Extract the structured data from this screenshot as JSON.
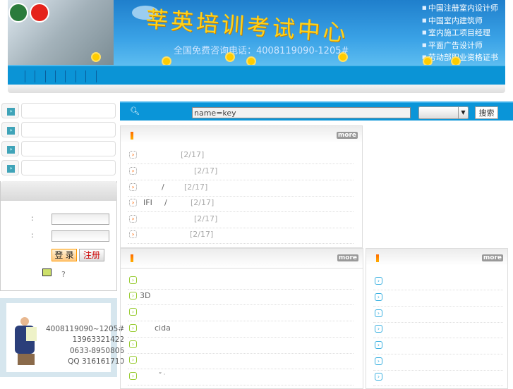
{
  "header": {
    "title": "莘英培训考试中心",
    "phone": "全国免费咨询电话：4008119090-1205#",
    "courses": [
      "中国注册室内设计师",
      "中国室内建筑师",
      "室内施工项目经理",
      "平面广告设计师",
      "劳动部职业资格证书"
    ]
  },
  "search": {
    "value": "name=key",
    "button": "搜索",
    "icon": "magnifier-icon"
  },
  "login": {
    "colon1": ":",
    "colon2": ":",
    "login_button": "登 录",
    "register_button": "注册",
    "help": "?"
  },
  "contact": {
    "lines": [
      "4008119090~1205#",
      "13963321422",
      "0633-8950806",
      "QQ 316161710"
    ]
  },
  "panels": {
    "more": "more",
    "news": [
      {
        "t": "",
        "d": "[2/17]"
      },
      {
        "t": "",
        "d": "[2/17]"
      },
      {
        "t": "/",
        "d": "[2/17]"
      },
      {
        "t": "IFI",
        "t2": "/",
        "d": "[2/17]"
      },
      {
        "t": "",
        "d": "[2/17]"
      },
      {
        "t": "",
        "d": "[2/17]"
      }
    ],
    "middle": [
      "",
      "3D",
      "",
      "cida",
      "",
      "",
      "“ ·"
    ]
  },
  "colors": {
    "accent": "#0a95d8",
    "title": "#ffd21a",
    "orange": "#ff6a00"
  }
}
